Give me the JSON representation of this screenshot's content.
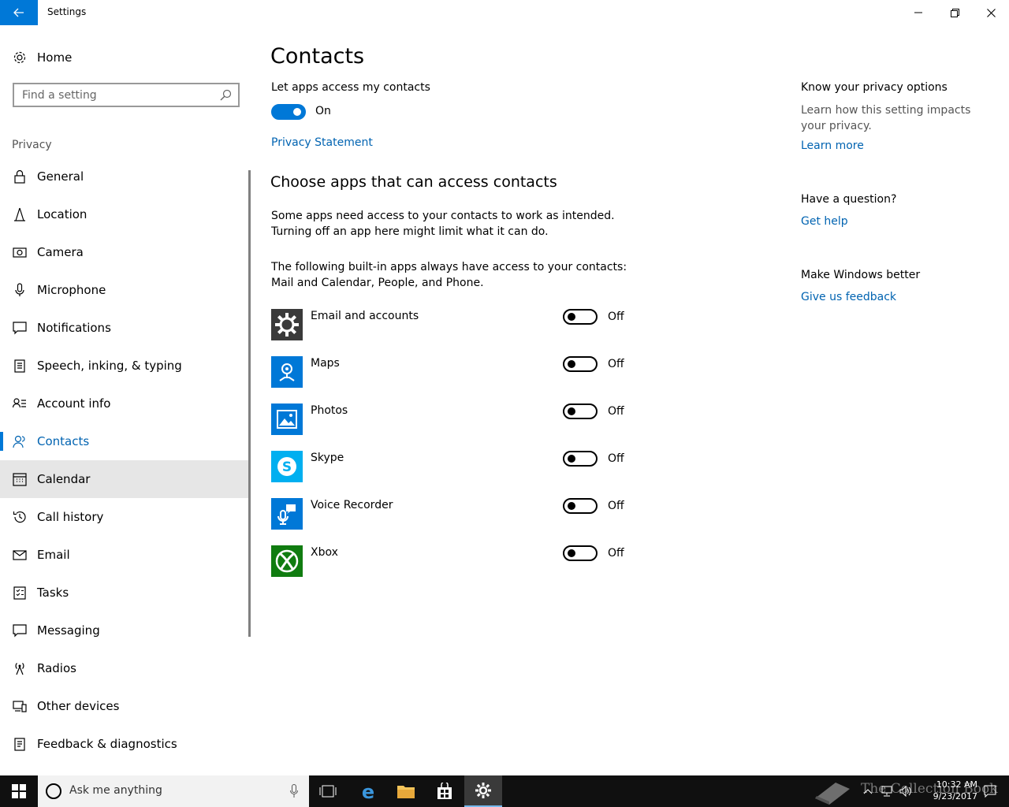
{
  "window": {
    "title": "Settings"
  },
  "sidebar": {
    "home_label": "Home",
    "search_placeholder": "Find a setting",
    "section": "Privacy",
    "items": [
      {
        "label": "General",
        "icon": "lock-icon"
      },
      {
        "label": "Location",
        "icon": "location-icon"
      },
      {
        "label": "Camera",
        "icon": "camera-icon"
      },
      {
        "label": "Microphone",
        "icon": "microphone-icon"
      },
      {
        "label": "Notifications",
        "icon": "notifications-icon"
      },
      {
        "label": "Speech, inking, & typing",
        "icon": "speech-icon"
      },
      {
        "label": "Account info",
        "icon": "account-info-icon"
      },
      {
        "label": "Contacts",
        "icon": "contacts-icon"
      },
      {
        "label": "Calendar",
        "icon": "calendar-icon"
      },
      {
        "label": "Call history",
        "icon": "history-icon"
      },
      {
        "label": "Email",
        "icon": "email-icon"
      },
      {
        "label": "Tasks",
        "icon": "tasks-icon"
      },
      {
        "label": "Messaging",
        "icon": "messaging-icon"
      },
      {
        "label": "Radios",
        "icon": "radios-icon"
      },
      {
        "label": "Other devices",
        "icon": "devices-icon"
      },
      {
        "label": "Feedback & diagnostics",
        "icon": "feedback-icon"
      }
    ],
    "active_item": "Contacts",
    "hover_item": "Calendar"
  },
  "main": {
    "title": "Contacts",
    "access_label": "Let apps access my contacts",
    "access_state": "On",
    "privacy_link": "Privacy Statement",
    "subheading": "Choose apps that can access contacts",
    "para1_line1": "Some apps need access to your contacts to work as intended.",
    "para1_line2": "Turning off an app here might limit what it can do.",
    "para2_line1": "The following built-in apps always have access to your contacts:",
    "para2_line2": "Mail and Calendar, People, and Phone.",
    "apps": [
      {
        "name": "Email and accounts",
        "state": "Off",
        "tile_color": "#3a3a3a",
        "icon": "gear-icon"
      },
      {
        "name": "Maps",
        "state": "Off",
        "tile_color": "#0078d7",
        "icon": "maps-icon"
      },
      {
        "name": "Photos",
        "state": "Off",
        "tile_color": "#0078d7",
        "icon": "photos-icon"
      },
      {
        "name": "Skype",
        "state": "Off",
        "tile_color": "#00aff0",
        "icon": "skype-icon"
      },
      {
        "name": "Voice Recorder",
        "state": "Off",
        "tile_color": "#0078d7",
        "icon": "voice-recorder-icon"
      },
      {
        "name": "Xbox",
        "state": "Off",
        "tile_color": "#107c10",
        "icon": "xbox-icon"
      }
    ]
  },
  "right": {
    "privacy_heading": "Know your privacy options",
    "privacy_text": "Learn how this setting impacts your privacy.",
    "learn_more": "Learn more",
    "question_heading": "Have a question?",
    "get_help": "Get help",
    "better_heading": "Make Windows better",
    "feedback_link": "Give us feedback"
  },
  "taskbar": {
    "search_placeholder": "Ask me anything",
    "time": "10:32 AM",
    "date": "9/23/2017",
    "watermark": "The Collection Book"
  },
  "colors": {
    "accent": "#0078d7",
    "link": "#0063b1",
    "hover": "#e6e6e6",
    "taskbar": "#101010"
  }
}
